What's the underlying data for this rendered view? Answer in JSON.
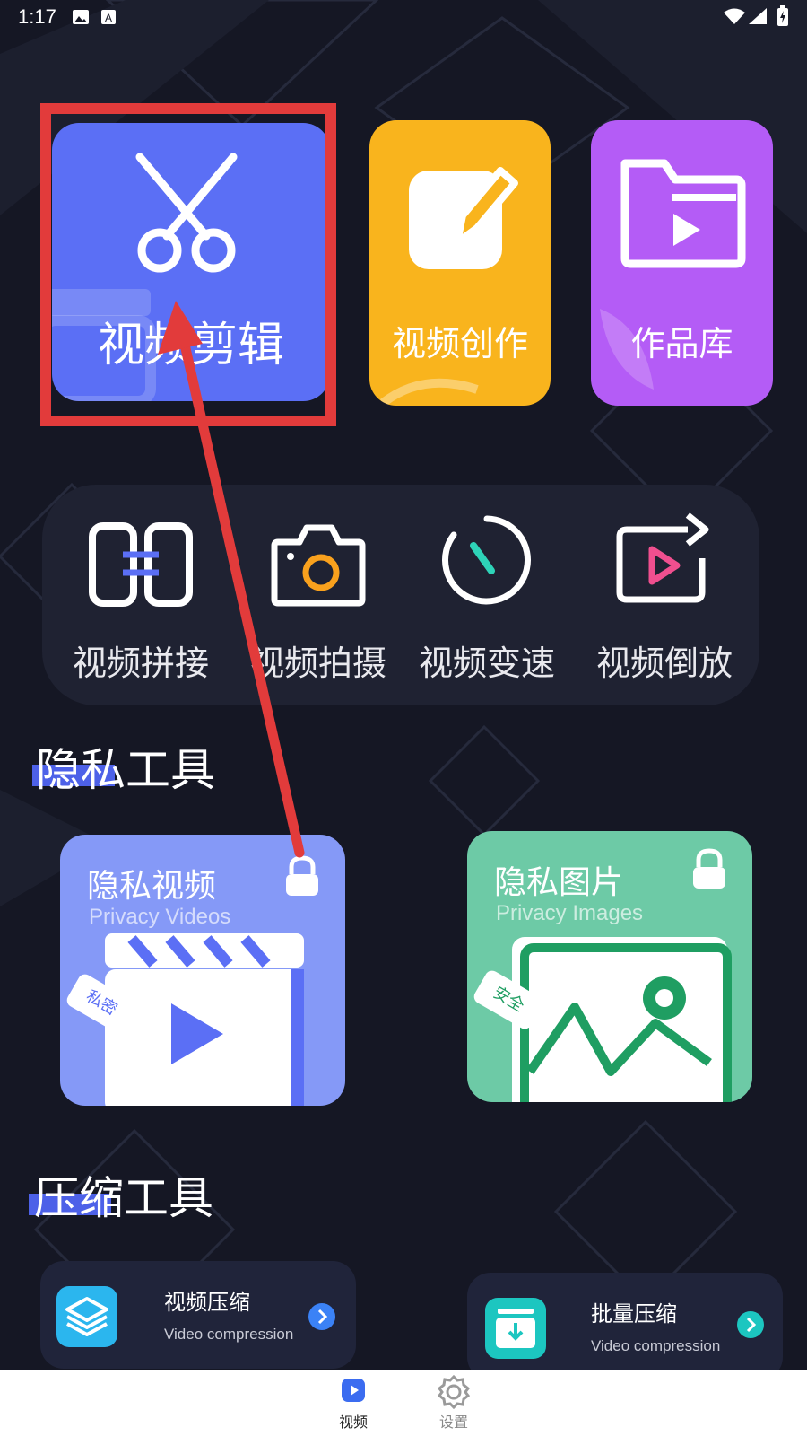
{
  "status_bar": {
    "time": "1:17"
  },
  "top_cards": {
    "edit_label": "视频剪辑",
    "create_label": "视频创作",
    "works_label": "作品库"
  },
  "tools": [
    {
      "label": "视频拼接"
    },
    {
      "label": "视频拍摄"
    },
    {
      "label": "视频变速"
    },
    {
      "label": "视频倒放"
    }
  ],
  "privacy": {
    "section_title": "隐私工具",
    "videos_title": "隐私视频",
    "videos_subtitle": "Privacy Videos",
    "videos_tag": "私密",
    "images_title": "隐私图片",
    "images_subtitle": "Privacy Images",
    "images_tag": "安全"
  },
  "compression": {
    "section_title": "压缩工具",
    "video_title": "视频压缩",
    "video_subtitle": "Video compression",
    "batch_title": "批量压缩",
    "batch_subtitle": "Video compression"
  },
  "bottom_nav": {
    "video_label": "视频",
    "settings_label": "设置"
  },
  "colors": {
    "background": "#151724",
    "edit_card": "#5b6ff5",
    "create_card": "#f9b41d",
    "works_card": "#b45cf6",
    "privacy_video_card": "#8599f7",
    "privacy_image_card": "#6dcaa6",
    "highlight": "#e23b3b",
    "nav_active": "#3b6cf0"
  }
}
